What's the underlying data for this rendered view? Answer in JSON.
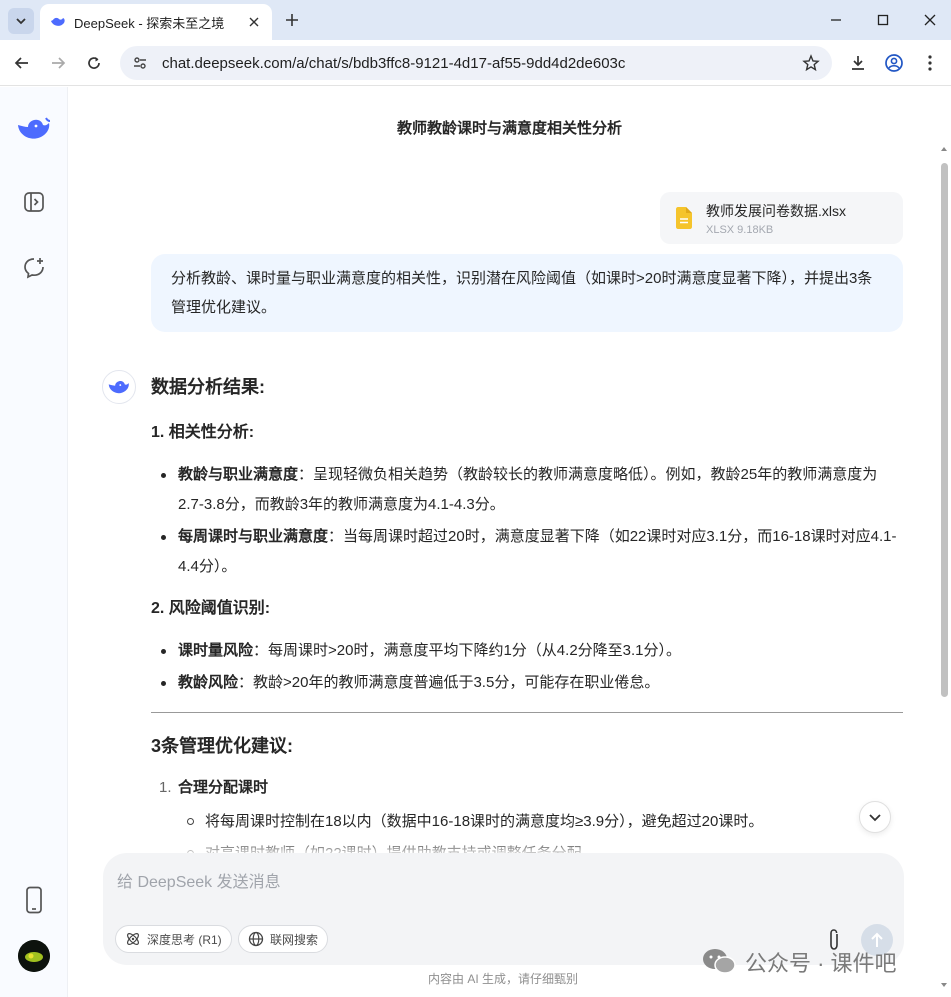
{
  "browser": {
    "tab_title": "DeepSeek - 探索未至之境",
    "url": "chat.deepseek.com/a/chat/s/bdb3ffc8-9121-4d17-af55-9dd4d2de603c"
  },
  "chat": {
    "title": "教师教龄课时与满意度相关性分析",
    "file": {
      "name": "教师发展问卷数据.xlsx",
      "meta": "XLSX 9.18KB"
    },
    "user_message": "分析教龄、课时量与职业满意度的相关性，识别潜在风险阈值（如课时>20时满意度显著下降），并提出3条管理优化建议。",
    "answer": {
      "heading": "数据分析结果:",
      "section1_title": "1. 相关性分析:",
      "section1_items": [
        {
          "bold": "教龄与职业满意度",
          "text": "：呈现轻微负相关趋势（教龄较长的教师满意度略低）。例如，教龄25年的教师满意度为2.7-3.8分，而教龄3年的教师满意度为4.1-4.3分。"
        },
        {
          "bold": "每周课时与职业满意度",
          "text": "：当每周课时超过20时，满意度显著下降（如22课时对应3.1分，而16-18课时对应4.1-4.4分）。"
        }
      ],
      "section2_title": "2. 风险阈值识别:",
      "section2_items": [
        {
          "bold": "课时量风险",
          "text": "：每周课时>20时，满意度平均下降约1分（从4.2分降至3.1分）。"
        },
        {
          "bold": "教龄风险",
          "text": "：教龄>20年的教师满意度普遍低于3.5分，可能存在职业倦怠。"
        }
      ],
      "section3_title": "3条管理优化建议:",
      "rec1_num": "1.",
      "rec1_title": "合理分配课时",
      "rec1_sub1": "将每周课时控制在18以内（数据中16-18课时的满意度均≥3.9分），避免超过20课时。",
      "rec1_sub2": "对高课时教师（如22课时）提供助教支持或调整任务分配。"
    }
  },
  "composer": {
    "placeholder": "给 DeepSeek 发送消息",
    "deep_think_label": "深度思考 (R1)",
    "web_search_label": "联网搜索"
  },
  "footer_note": "内容由 AI 生成，请仔细甄别",
  "watermark": "公众号 · 课件吧",
  "colors": {
    "brand": "#4d6bfe",
    "bubble": "#eff6ff"
  }
}
